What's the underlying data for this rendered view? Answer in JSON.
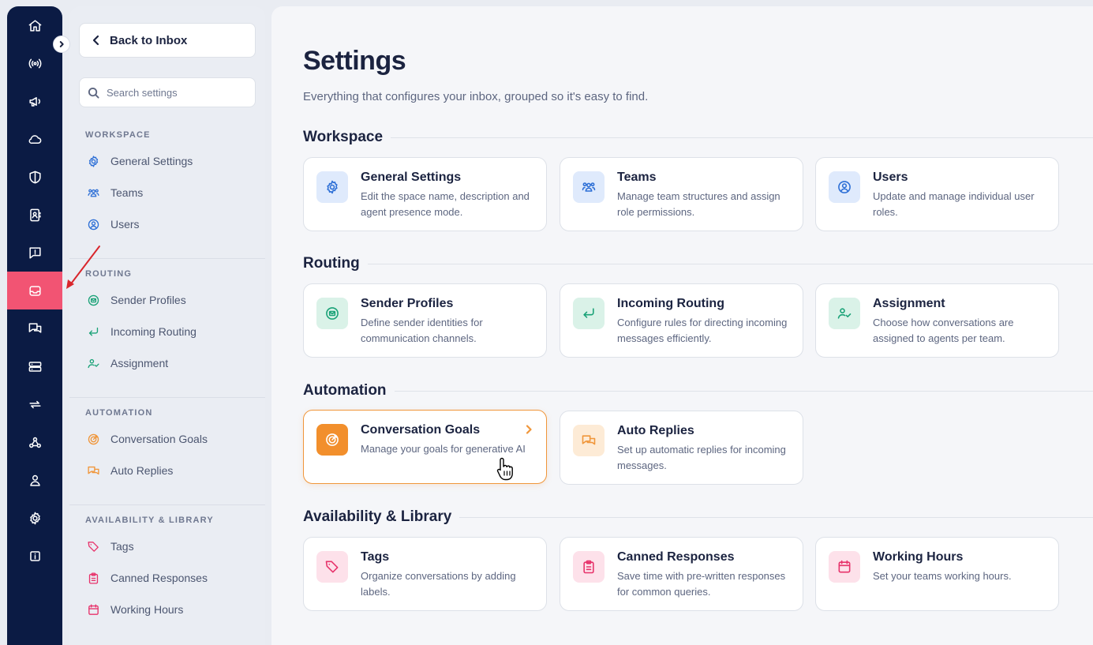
{
  "rail": {
    "items": [
      {
        "icon": "home-icon"
      },
      {
        "icon": "broadcast-icon"
      },
      {
        "icon": "megaphone-icon"
      },
      {
        "icon": "cloud-icon"
      },
      {
        "icon": "shield-icon"
      },
      {
        "icon": "contacts-icon"
      },
      {
        "icon": "chat-alert-icon"
      },
      {
        "icon": "inbox-icon",
        "active": true
      },
      {
        "icon": "conversations-icon"
      },
      {
        "icon": "server-icon"
      },
      {
        "icon": "sync-icon"
      },
      {
        "icon": "webhook-icon"
      },
      {
        "icon": "user-icon"
      },
      {
        "icon": "gear-icon"
      },
      {
        "icon": "info-icon"
      }
    ],
    "active_color": "#f25473",
    "background": "#0b1b44"
  },
  "nav": {
    "back_label": "Back to Inbox",
    "search_placeholder": "Search settings",
    "sections": {
      "workspace": {
        "title": "WORKSPACE",
        "items": [
          "General Settings",
          "Teams",
          "Users"
        ]
      },
      "routing": {
        "title": "ROUTING",
        "items": [
          "Sender Profiles",
          "Incoming Routing",
          "Assignment"
        ]
      },
      "automation": {
        "title": "AUTOMATION",
        "items": [
          "Conversation Goals",
          "Auto Replies"
        ]
      },
      "library": {
        "title": "AVAILABILITY & LIBRARY",
        "items": [
          "Tags",
          "Canned Responses",
          "Working Hours"
        ]
      }
    }
  },
  "main": {
    "title": "Settings",
    "subtitle": "Everything that configures your inbox, grouped so it's easy to find.",
    "sections": {
      "workspace": {
        "title": "Workspace",
        "cards": [
          {
            "title": "General Settings",
            "desc": "Edit the space name, description and agent presence mode."
          },
          {
            "title": "Teams",
            "desc": "Manage team structures and assign role permissions."
          },
          {
            "title": "Users",
            "desc": "Update and manage individual user roles."
          }
        ]
      },
      "routing": {
        "title": "Routing",
        "cards": [
          {
            "title": "Sender Profiles",
            "desc": "Define sender identities for communication channels."
          },
          {
            "title": "Incoming Routing",
            "desc": "Configure rules for directing incoming messages efficiently."
          },
          {
            "title": "Assignment",
            "desc": "Choose how conversations are assigned to agents per team."
          }
        ]
      },
      "automation": {
        "title": "Automation",
        "cards": [
          {
            "title": "Conversation Goals",
            "desc": "Manage your goals for generative AI"
          },
          {
            "title": "Auto Replies",
            "desc": "Set up automatic replies for incoming messages."
          }
        ]
      },
      "library": {
        "title": "Availability & Library",
        "cards": [
          {
            "title": "Tags",
            "desc": "Organize conversations by adding labels."
          },
          {
            "title": "Canned Responses",
            "desc": "Save time with pre-written responses for common queries."
          },
          {
            "title": "Working Hours",
            "desc": "Set your teams working hours."
          }
        ]
      }
    }
  },
  "colors": {
    "workspace": "#2d6fd6",
    "routing": "#1aa277",
    "automation": "#f0963a",
    "library": "#e7336b",
    "annotation_arrow": "#d9262c"
  }
}
